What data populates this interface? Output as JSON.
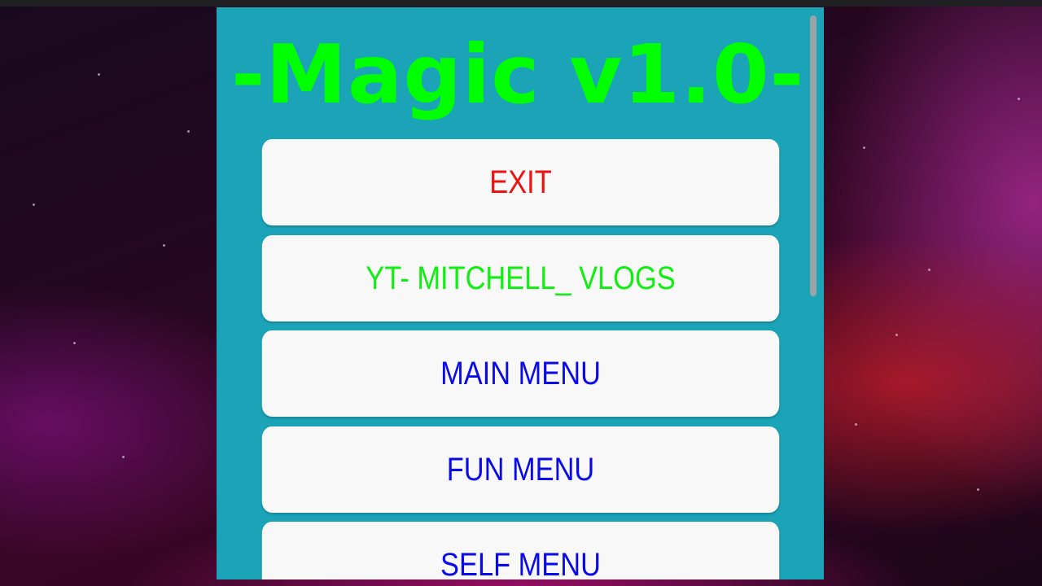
{
  "title": "-Magic v1.0-",
  "colors": {
    "panel_background": "#1ba3b8",
    "title": "#00ff00",
    "exit": "#ee1111",
    "channel": "#11ee11",
    "menu": "#0a0ae8",
    "button_background": "#f8f8f8"
  },
  "buttons": [
    {
      "label": "EXIT",
      "color": "#ee1111"
    },
    {
      "label": "YT- MITCHELL_ VLOGS",
      "color": "#11ee11"
    },
    {
      "label": "MAIN MENU",
      "color": "#0a0ae8"
    },
    {
      "label": "FUN MENU",
      "color": "#0a0ae8"
    },
    {
      "label": "SELF MENU",
      "color": "#0a0ae8"
    }
  ],
  "scrollbar": {
    "visible_fraction": 0.5
  }
}
